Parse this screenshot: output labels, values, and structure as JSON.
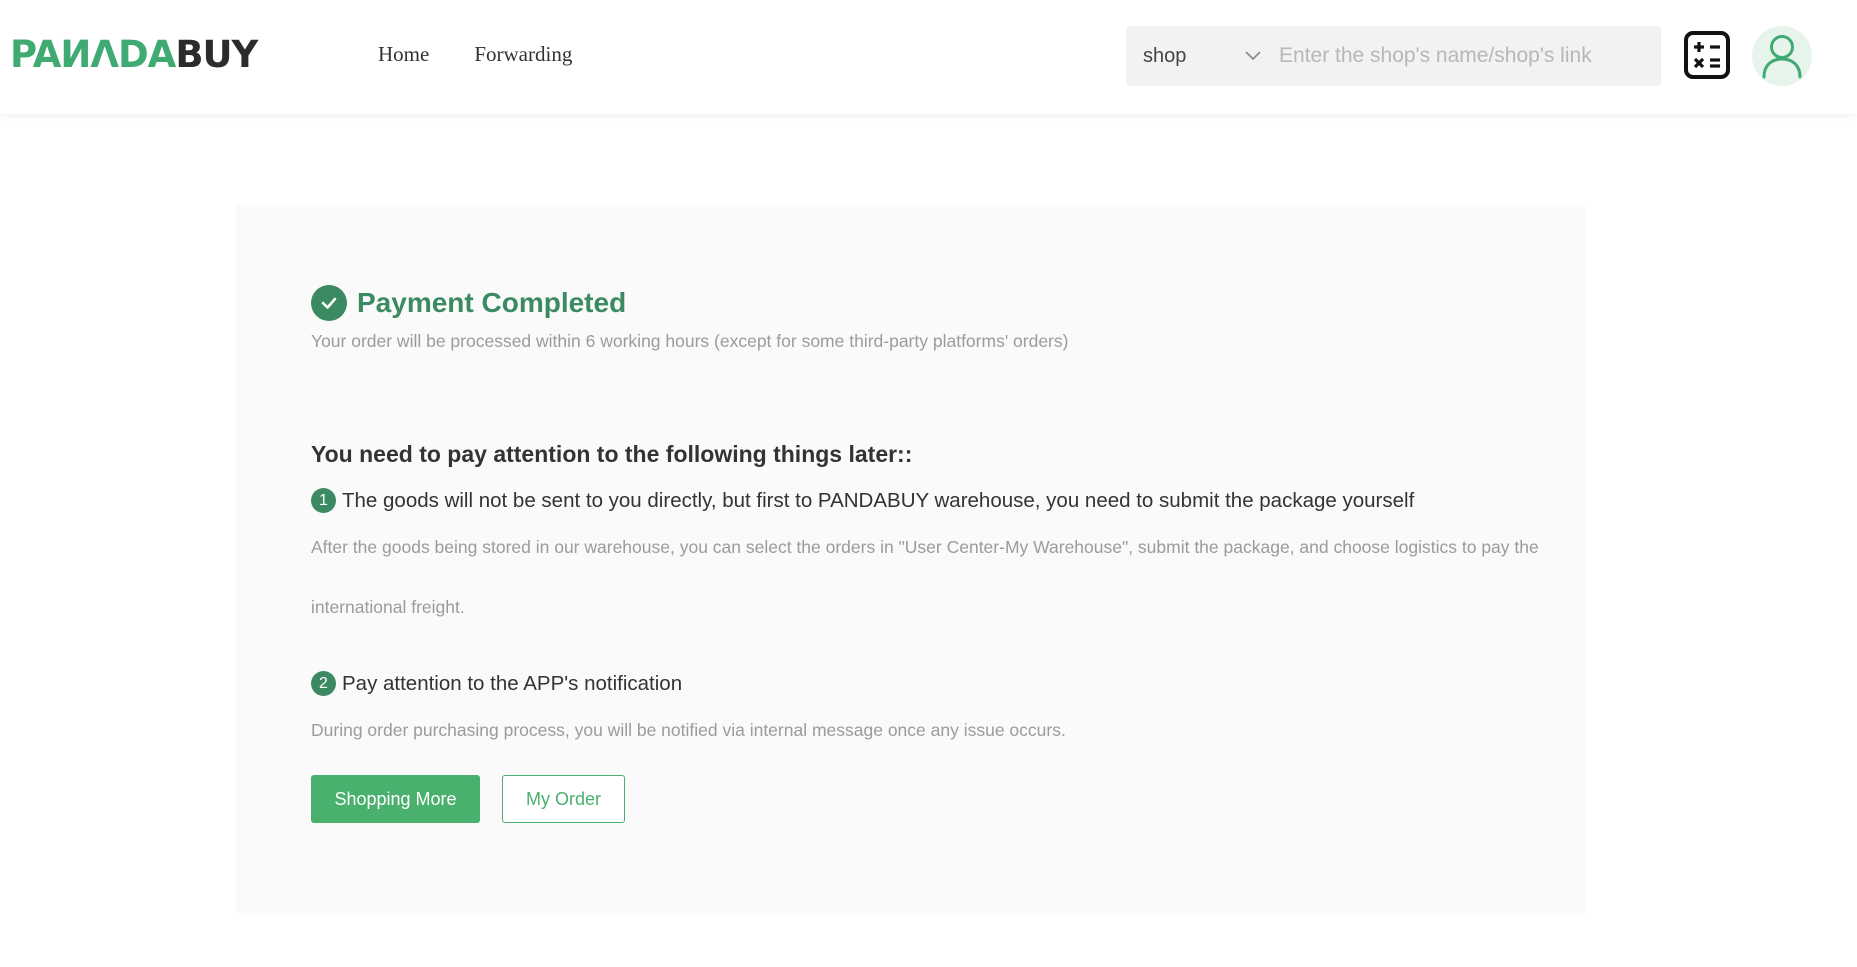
{
  "brand": {
    "logo_green": "PAИΛDA",
    "logo_dark": "BUY",
    "accent": "#3faa72",
    "dark_green": "#3b8a62"
  },
  "nav": {
    "home": "Home",
    "forwarding": "Forwarding"
  },
  "search": {
    "scope": "shop",
    "placeholder": "Enter the shop's name/shop's link"
  },
  "header_icons": {
    "calculator": "calculator-icon",
    "avatar": "user-icon"
  },
  "result": {
    "title": "Payment Completed",
    "subtitle": "Your order will be processed within 6 working hours (except for some third-party platforms' orders)",
    "attention_heading": "You need to pay attention to the following things later::",
    "items": [
      {
        "number": "1",
        "heading": "The goods will not be sent to you directly, but first to PANDABUY warehouse, you need to submit the package yourself",
        "description": "After the goods being stored in our warehouse, you can select the orders in \"User Center-My Warehouse\", submit the package, and choose logistics to pay the international freight."
      },
      {
        "number": "2",
        "heading": "Pay attention to the APP's notification",
        "description": "During order purchasing process, you will be notified via internal message once any issue occurs."
      }
    ],
    "shopping_more_label": "Shopping More",
    "my_order_label": "My Order"
  }
}
